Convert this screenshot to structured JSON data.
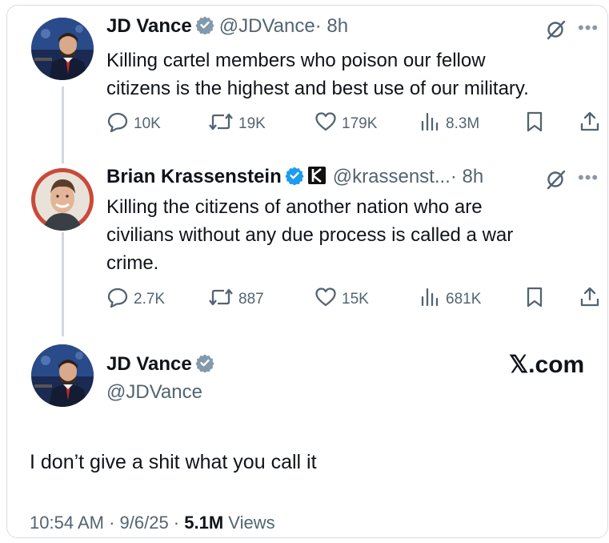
{
  "tweet1": {
    "name": "JD Vance",
    "handle": "@JDVance",
    "time": "· 8h",
    "text_line1": "Killing cartel members who poison our fellow",
    "text_line2": "citizens is the highest and best use of our military.",
    "replies": "10K",
    "reposts": "19K",
    "likes": "179K",
    "views": "8.3M"
  },
  "tweet2": {
    "name": "Brian Krassenstein",
    "handle": "@krassenst...",
    "time": "· 8h",
    "text_line1": "Killing the citizens of another nation who are",
    "text_line2": "civilians without any due process is called a war",
    "text_line3": "crime.",
    "replies": "2.7K",
    "reposts": "887",
    "likes": "15K",
    "views": "681K"
  },
  "tweet3": {
    "name": "JD Vance",
    "handle": "@JDVance",
    "text": "I don’t give a shit what you call it",
    "watermark": "𝕏.com",
    "time": "10:54 AM",
    "date": "9/6/25",
    "view_count": "5.1M",
    "views_label": "Views"
  },
  "icons": {
    "verified": "verified-badge-icon",
    "grok": "grok-icon",
    "more": "more-icon",
    "reply": "reply-icon",
    "repost": "repost-icon",
    "like": "like-icon",
    "views": "views-icon",
    "bookmark": "bookmark-icon",
    "share": "share-icon"
  },
  "colors": {
    "verified_blue": "#1d9bf0",
    "verified_gray": "#829aab",
    "muted": "#536471",
    "rail": "#cfd9de"
  }
}
